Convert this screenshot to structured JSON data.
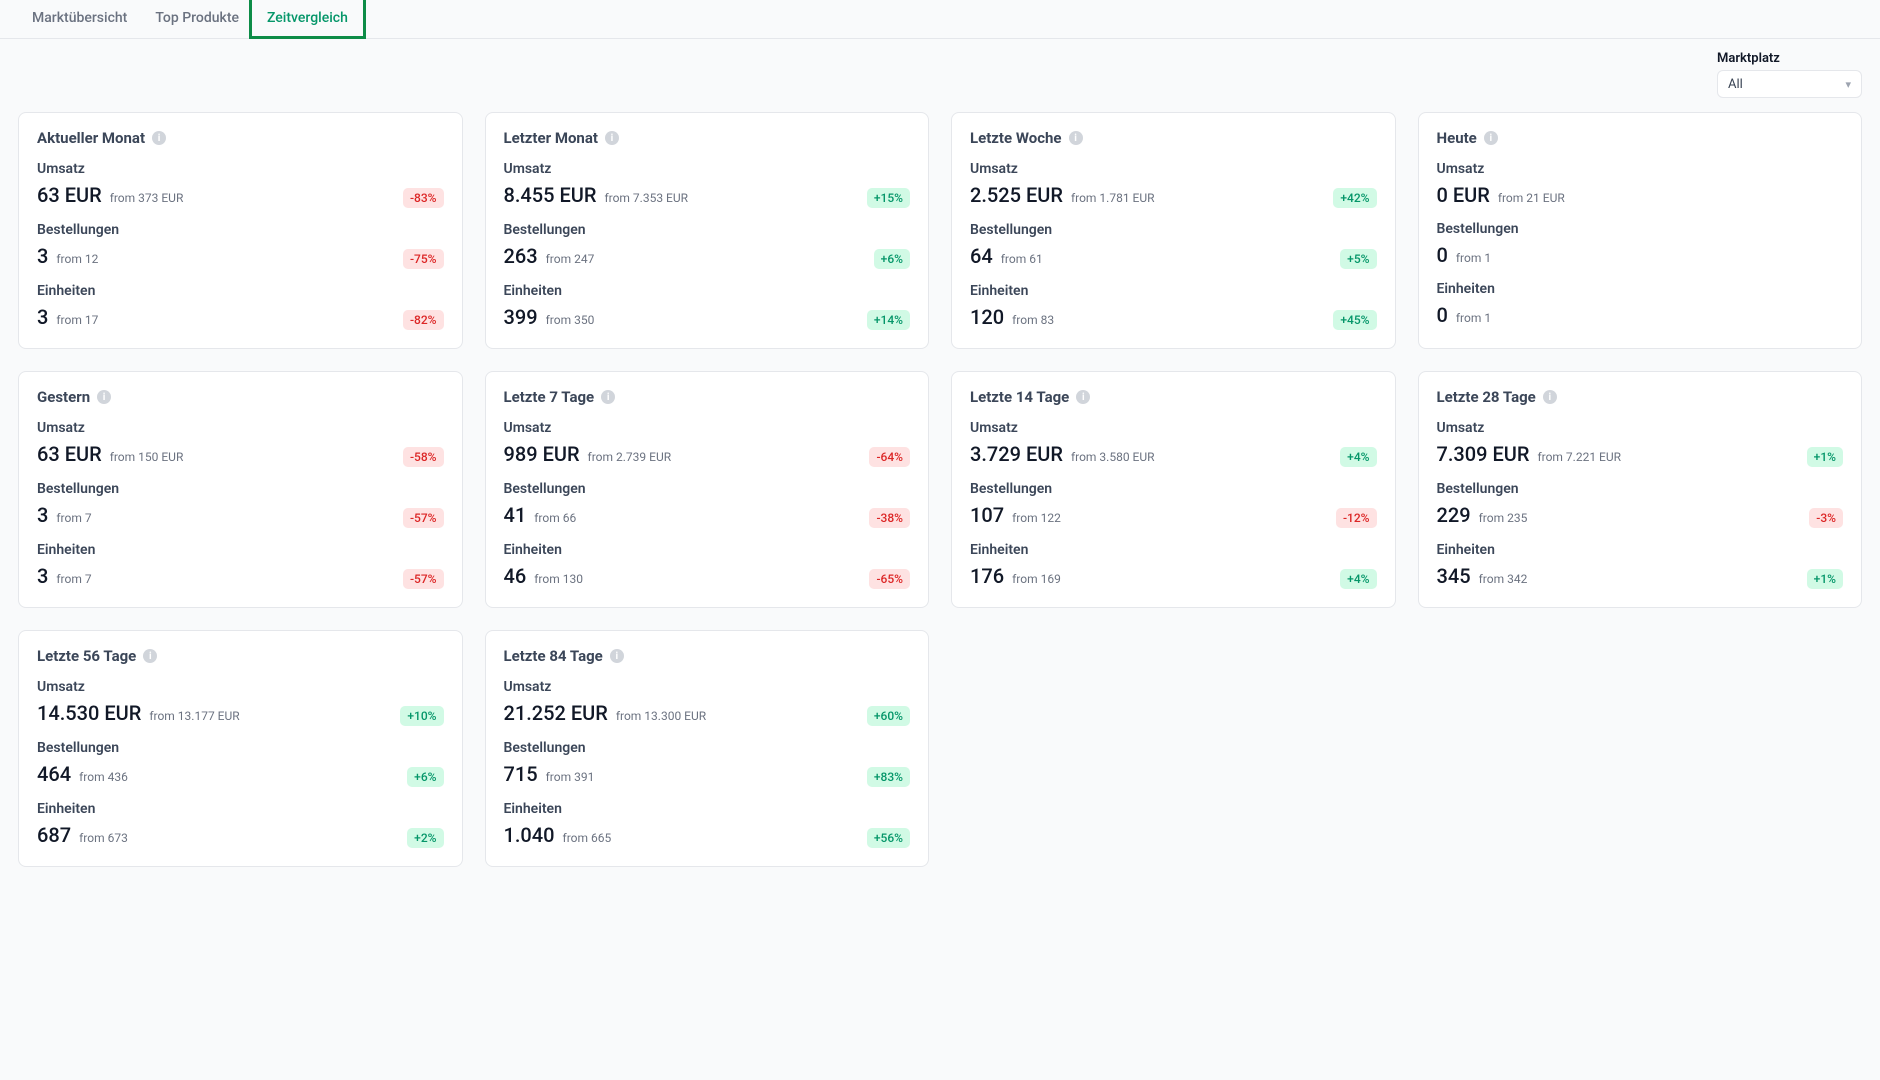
{
  "tabs": [
    {
      "label": "Marktübersicht",
      "active": false
    },
    {
      "label": "Top Produkte",
      "active": false
    },
    {
      "label": "Zeitvergleich",
      "active": true
    }
  ],
  "filter": {
    "label": "Marktplatz",
    "value": "All"
  },
  "fromPrefix": "from",
  "metricLabels": {
    "umsatz": "Umsatz",
    "bestellungen": "Bestellungen",
    "einheiten": "Einheiten"
  },
  "cards": [
    {
      "title": "Aktueller Monat",
      "metrics": [
        {
          "key": "umsatz",
          "value": "63 EUR",
          "from": "373 EUR",
          "delta": "-83%",
          "sign": "neg"
        },
        {
          "key": "bestellungen",
          "value": "3",
          "from": "12",
          "delta": "-75%",
          "sign": "neg"
        },
        {
          "key": "einheiten",
          "value": "3",
          "from": "17",
          "delta": "-82%",
          "sign": "neg"
        }
      ]
    },
    {
      "title": "Letzter Monat",
      "metrics": [
        {
          "key": "umsatz",
          "value": "8.455 EUR",
          "from": "7.353 EUR",
          "delta": "+15%",
          "sign": "pos"
        },
        {
          "key": "bestellungen",
          "value": "263",
          "from": "247",
          "delta": "+6%",
          "sign": "pos"
        },
        {
          "key": "einheiten",
          "value": "399",
          "from": "350",
          "delta": "+14%",
          "sign": "pos"
        }
      ]
    },
    {
      "title": "Letzte Woche",
      "metrics": [
        {
          "key": "umsatz",
          "value": "2.525 EUR",
          "from": "1.781 EUR",
          "delta": "+42%",
          "sign": "pos"
        },
        {
          "key": "bestellungen",
          "value": "64",
          "from": "61",
          "delta": "+5%",
          "sign": "pos"
        },
        {
          "key": "einheiten",
          "value": "120",
          "from": "83",
          "delta": "+45%",
          "sign": "pos"
        }
      ]
    },
    {
      "title": "Heute",
      "metrics": [
        {
          "key": "umsatz",
          "value": "0 EUR",
          "from": "21 EUR",
          "delta": null
        },
        {
          "key": "bestellungen",
          "value": "0",
          "from": "1",
          "delta": null
        },
        {
          "key": "einheiten",
          "value": "0",
          "from": "1",
          "delta": null
        }
      ]
    },
    {
      "title": "Gestern",
      "metrics": [
        {
          "key": "umsatz",
          "value": "63 EUR",
          "from": "150 EUR",
          "delta": "-58%",
          "sign": "neg"
        },
        {
          "key": "bestellungen",
          "value": "3",
          "from": "7",
          "delta": "-57%",
          "sign": "neg"
        },
        {
          "key": "einheiten",
          "value": "3",
          "from": "7",
          "delta": "-57%",
          "sign": "neg"
        }
      ]
    },
    {
      "title": "Letzte 7 Tage",
      "metrics": [
        {
          "key": "umsatz",
          "value": "989 EUR",
          "from": "2.739 EUR",
          "delta": "-64%",
          "sign": "neg"
        },
        {
          "key": "bestellungen",
          "value": "41",
          "from": "66",
          "delta": "-38%",
          "sign": "neg"
        },
        {
          "key": "einheiten",
          "value": "46",
          "from": "130",
          "delta": "-65%",
          "sign": "neg"
        }
      ]
    },
    {
      "title": "Letzte 14 Tage",
      "metrics": [
        {
          "key": "umsatz",
          "value": "3.729 EUR",
          "from": "3.580 EUR",
          "delta": "+4%",
          "sign": "pos"
        },
        {
          "key": "bestellungen",
          "value": "107",
          "from": "122",
          "delta": "-12%",
          "sign": "neg"
        },
        {
          "key": "einheiten",
          "value": "176",
          "from": "169",
          "delta": "+4%",
          "sign": "pos"
        }
      ]
    },
    {
      "title": "Letzte 28 Tage",
      "metrics": [
        {
          "key": "umsatz",
          "value": "7.309 EUR",
          "from": "7.221 EUR",
          "delta": "+1%",
          "sign": "pos"
        },
        {
          "key": "bestellungen",
          "value": "229",
          "from": "235",
          "delta": "-3%",
          "sign": "neg"
        },
        {
          "key": "einheiten",
          "value": "345",
          "from": "342",
          "delta": "+1%",
          "sign": "pos"
        }
      ]
    },
    {
      "title": "Letzte 56 Tage",
      "metrics": [
        {
          "key": "umsatz",
          "value": "14.530 EUR",
          "from": "13.177 EUR",
          "delta": "+10%",
          "sign": "pos"
        },
        {
          "key": "bestellungen",
          "value": "464",
          "from": "436",
          "delta": "+6%",
          "sign": "pos"
        },
        {
          "key": "einheiten",
          "value": "687",
          "from": "673",
          "delta": "+2%",
          "sign": "pos"
        }
      ]
    },
    {
      "title": "Letzte 84 Tage",
      "metrics": [
        {
          "key": "umsatz",
          "value": "21.252 EUR",
          "from": "13.300 EUR",
          "delta": "+60%",
          "sign": "pos"
        },
        {
          "key": "bestellungen",
          "value": "715",
          "from": "391",
          "delta": "+83%",
          "sign": "pos"
        },
        {
          "key": "einheiten",
          "value": "1.040",
          "from": "665",
          "delta": "+56%",
          "sign": "pos"
        }
      ]
    }
  ]
}
